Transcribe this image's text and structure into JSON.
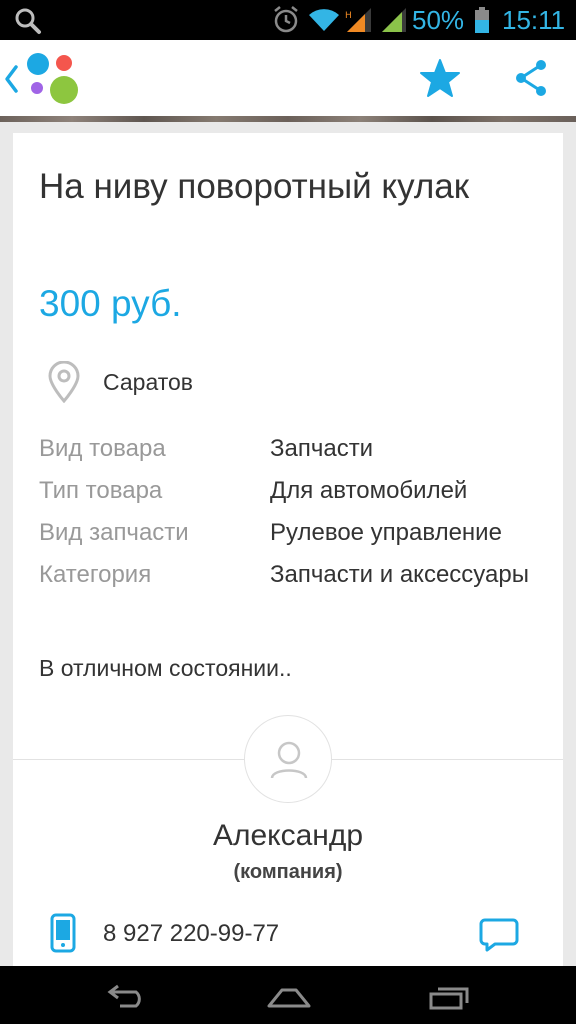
{
  "status_bar": {
    "battery_percent": "50%",
    "time": "15:11",
    "icons": [
      "search-icon",
      "alarm-icon",
      "wifi-icon",
      "signal-icon",
      "signal-icon",
      "battery-icon"
    ],
    "accent_color": "#33b5e5"
  },
  "app_bar": {
    "icons": [
      "back-icon",
      "app-logo",
      "favorite-star-icon",
      "share-icon"
    ],
    "accent_color": "#1ca8e3"
  },
  "listing": {
    "title": "На ниву поворотный кулак",
    "price": "300 руб.",
    "location": "Саратов",
    "params": [
      {
        "key": "Вид товара",
        "value": "Запчасти"
      },
      {
        "key": "Тип товара",
        "value": "Для автомобилей"
      },
      {
        "key": "Вид запчасти",
        "value": "Рулевое управление"
      },
      {
        "key": "Категория",
        "value": "Запчасти и аксессуары"
      }
    ],
    "description": "В отличном состоянии.."
  },
  "seller": {
    "name": "Александр",
    "type": "(компания)",
    "phone": "8 927 220-99-77"
  },
  "nav_bar": {
    "icons": [
      "back-nav-icon",
      "home-nav-icon",
      "recents-nav-icon"
    ]
  }
}
